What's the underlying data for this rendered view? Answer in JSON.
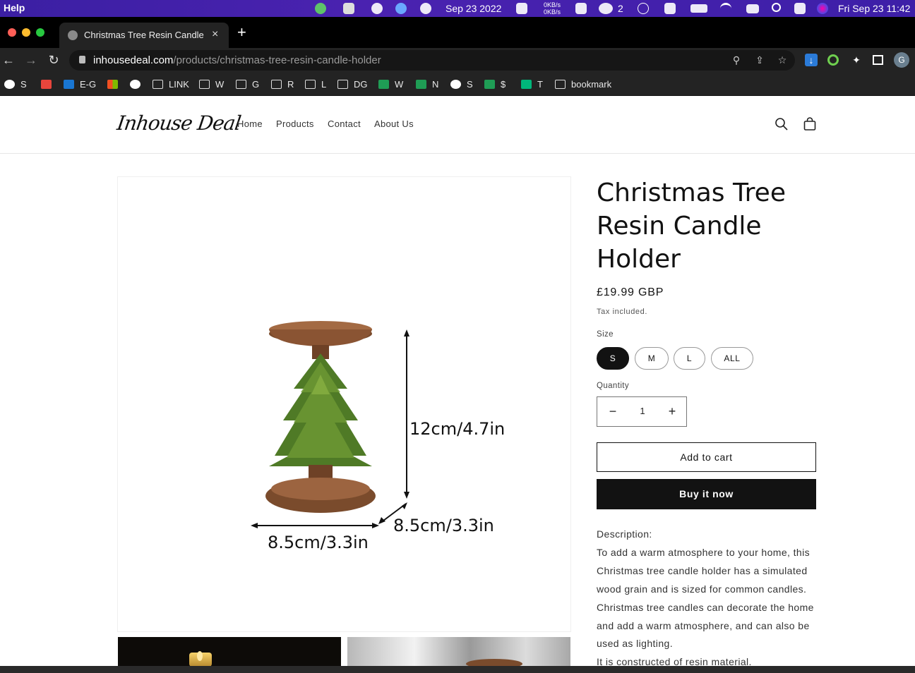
{
  "menubar": {
    "app_menu": "Help",
    "date_widget": "Sep 23 2022",
    "net_up": "0KB/s",
    "net_down": "0KB/s",
    "wechat_count": "2",
    "clock": "Fri Sep 23  11:42",
    "accent": "#3b1fa3"
  },
  "browser": {
    "tab_title": "Christmas Tree Resin Candle Holder",
    "new_tab": "+",
    "close_tab": "×",
    "url_host": "inhousedeal.com",
    "url_path": "/products/christmas-tree-resin-candle-holder",
    "profile_initial": "G"
  },
  "bookmarks": [
    {
      "label": "S",
      "icon": "globe-icon"
    },
    {
      "label": "",
      "icon": "gmail-icon"
    },
    {
      "label": "E-G",
      "icon": "outlook-icon"
    },
    {
      "label": "",
      "icon": "microsoft-icon"
    },
    {
      "label": "",
      "icon": "globe-icon"
    },
    {
      "label": "LINK",
      "icon": "folder-icon"
    },
    {
      "label": "W",
      "icon": "folder-icon"
    },
    {
      "label": "G",
      "icon": "folder-icon"
    },
    {
      "label": "R",
      "icon": "folder-icon"
    },
    {
      "label": "L",
      "icon": "folder-icon"
    },
    {
      "label": "DG",
      "icon": "folder-icon"
    },
    {
      "label": "W",
      "icon": "sheet-icon"
    },
    {
      "label": "N",
      "icon": "sheet-icon"
    },
    {
      "label": "S",
      "icon": "globe-icon"
    },
    {
      "label": "$",
      "icon": "sheet-icon"
    },
    {
      "label": "T",
      "icon": "star-icon"
    },
    {
      "label": "bookmark",
      "icon": "folder-icon"
    }
  ],
  "site": {
    "logo": "Inhouse Deal",
    "nav": [
      "Home",
      "Products",
      "Contact",
      "About Us"
    ]
  },
  "product": {
    "title": "Christmas Tree Resin Candle Holder",
    "price": "£19.99 GBP",
    "tax_note": "Tax included.",
    "size_label": "Size",
    "sizes": [
      "S",
      "M",
      "L",
      "ALL"
    ],
    "selected_size": "S",
    "quantity_label": "Quantity",
    "quantity": "1",
    "qty_minus": "−",
    "qty_plus": "+",
    "add_to_cart": "Add to cart",
    "buy_now": "Buy it now",
    "description_heading": "Description:",
    "description": "To add a warm atmosphere to your home, this Christmas tree candle holder has a simulated wood grain and is sized for common candles. Christmas tree candles can decorate the home and add a warm atmosphere, and can also be used as lighting.",
    "description_2": "It is constructed of resin material.",
    "image_labels": {
      "height": "12cm/4.7in",
      "depth": "8.5cm/3.3in",
      "width": "8.5cm/3.3in"
    }
  }
}
